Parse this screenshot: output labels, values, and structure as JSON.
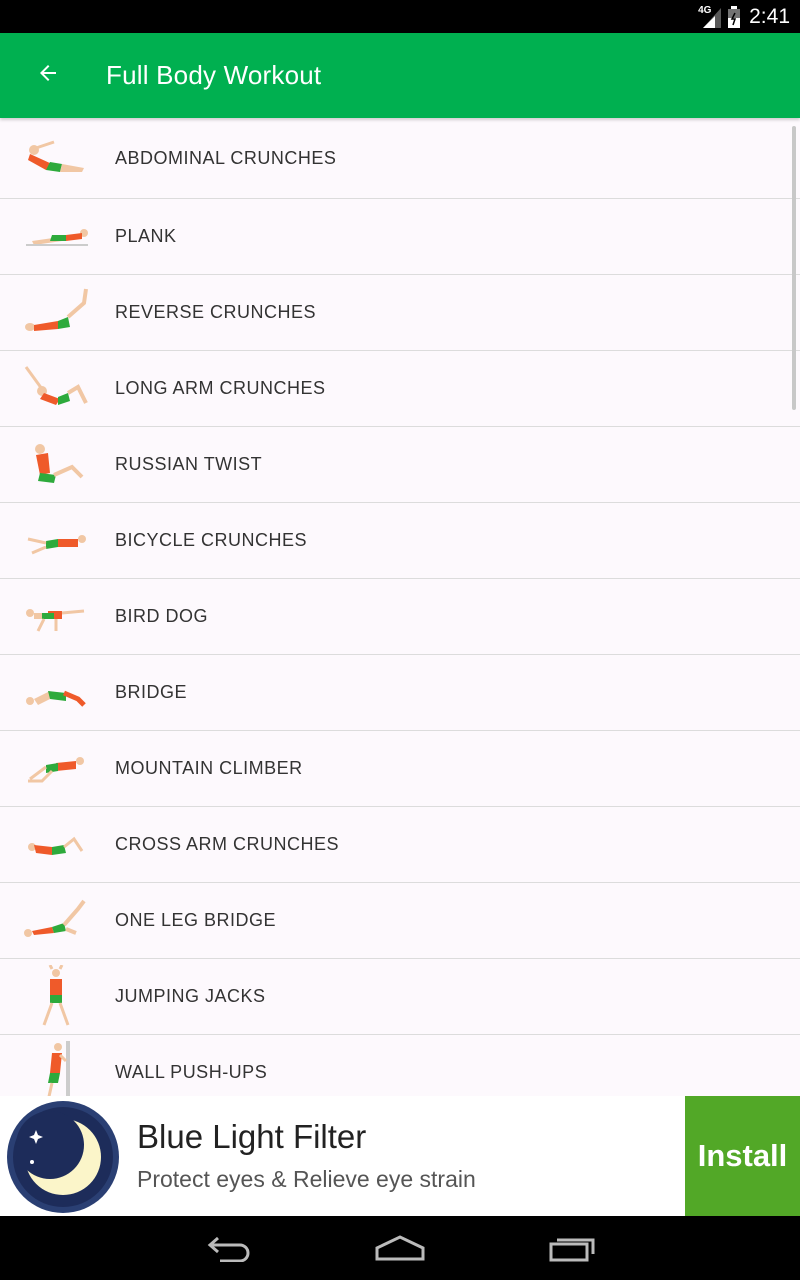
{
  "status_bar": {
    "network_label": "4G",
    "time": "2:41"
  },
  "app_bar": {
    "title": "Full Body Workout",
    "back_icon": "arrow-left-icon"
  },
  "exercises": [
    {
      "name": "ABDOMINAL CRUNCHES",
      "icon": "abdominal-crunches-icon"
    },
    {
      "name": "PLANK",
      "icon": "plank-icon"
    },
    {
      "name": "REVERSE CRUNCHES",
      "icon": "reverse-crunches-icon"
    },
    {
      "name": "LONG ARM CRUNCHES",
      "icon": "long-arm-crunches-icon"
    },
    {
      "name": "RUSSIAN TWIST",
      "icon": "russian-twist-icon"
    },
    {
      "name": "BICYCLE CRUNCHES",
      "icon": "bicycle-crunches-icon"
    },
    {
      "name": "BIRD DOG",
      "icon": "bird-dog-icon"
    },
    {
      "name": "BRIDGE",
      "icon": "bridge-icon"
    },
    {
      "name": "MOUNTAIN CLIMBER",
      "icon": "mountain-climber-icon"
    },
    {
      "name": "CROSS ARM CRUNCHES",
      "icon": "cross-arm-crunches-icon"
    },
    {
      "name": "ONE LEG BRIDGE",
      "icon": "one-leg-bridge-icon"
    },
    {
      "name": "JUMPING JACKS",
      "icon": "jumping-jacks-icon"
    },
    {
      "name": "WALL PUSH-UPS",
      "icon": "wall-push-ups-icon"
    }
  ],
  "ad": {
    "title": "Blue Light Filter",
    "subtitle": "Protect eyes & Relieve eye strain",
    "button_label": "Install",
    "icon": "moon-icon"
  },
  "colors": {
    "app_bar": "#00b050",
    "install_button": "#52a827",
    "shirt": "#ef5a2a",
    "shorts": "#2eaa3c"
  },
  "nav_bar": {
    "icons": [
      "back-nav-icon",
      "home-nav-icon",
      "recents-nav-icon"
    ]
  }
}
